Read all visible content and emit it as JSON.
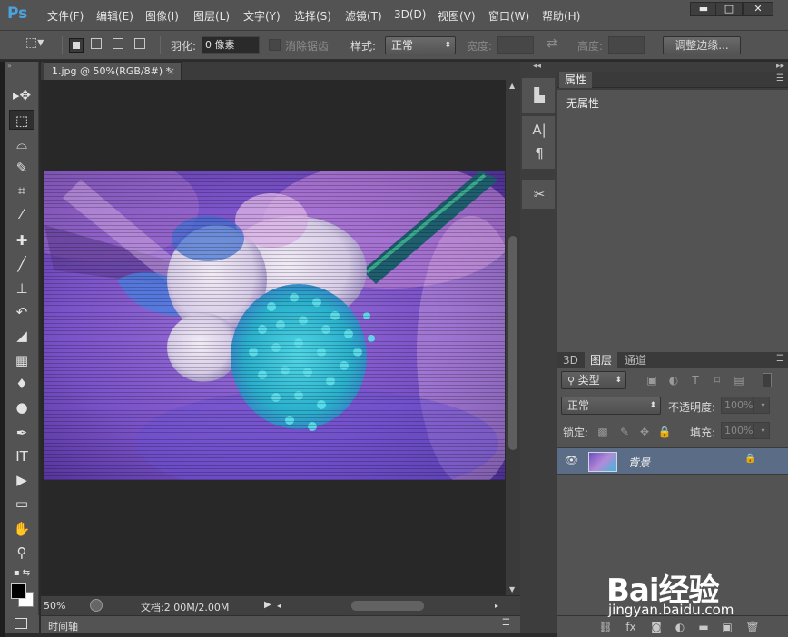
{
  "app": {
    "logo": "Ps"
  },
  "menu": [
    "文件(F)",
    "编辑(E)",
    "图像(I)",
    "图层(L)",
    "文字(Y)",
    "选择(S)",
    "滤镜(T)",
    "3D(D)",
    "视图(V)",
    "窗口(W)",
    "帮助(H)"
  ],
  "window_controls": {
    "minimize": "▬",
    "maximize": "□",
    "close": "✕"
  },
  "options": {
    "feather_label": "羽化:",
    "feather_value": "0 像素",
    "antialias_label": "消除锯齿",
    "style_label": "样式:",
    "style_value": "正常",
    "width_label": "宽度:",
    "height_label": "高度:",
    "refine_edge": "调整边缘..."
  },
  "document": {
    "tab_title": "1.jpg @ 50%(RGB/8#) *",
    "zoom": "50%",
    "doc_info": "文档:2.00M/2.00M"
  },
  "timeline": {
    "label": "时间轴"
  },
  "properties": {
    "tab": "属性",
    "message": "无属性"
  },
  "layers": {
    "tabs": [
      "3D",
      "图层",
      "通道"
    ],
    "filter_kind": "类型",
    "blend_mode": "正常",
    "opacity_label": "不透明度:",
    "opacity_value": "100%",
    "lock_label": "锁定:",
    "fill_label": "填充:",
    "fill_value": "100%",
    "items": [
      {
        "name": "背景",
        "visible": true,
        "locked": true
      }
    ]
  },
  "watermark": {
    "logo": "Bai经验",
    "url": "jingyan.baidu.com"
  }
}
